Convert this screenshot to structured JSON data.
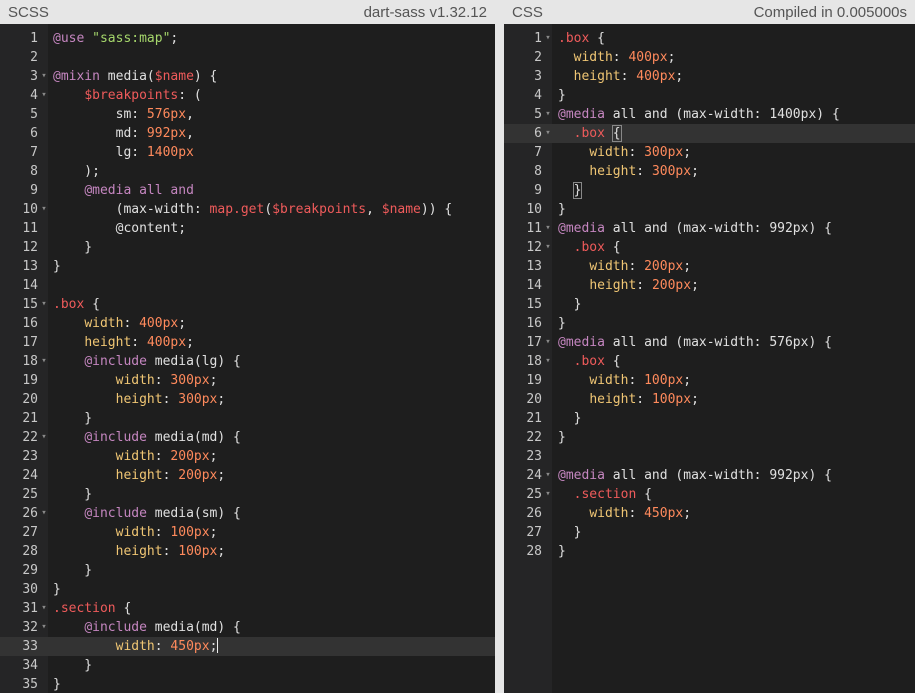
{
  "scss_pane": {
    "title": "SCSS",
    "compiler": "dart-sass v1.32.12",
    "lines": [
      {
        "n": "1",
        "fold": false,
        "tokens": [
          [
            "kw",
            "@use "
          ],
          [
            "str",
            "\"sass:map\""
          ],
          [
            "plain",
            ";"
          ]
        ]
      },
      {
        "n": "2",
        "fold": false,
        "tokens": []
      },
      {
        "n": "3",
        "fold": true,
        "tokens": [
          [
            "kw",
            "@mixin "
          ],
          [
            "plain",
            "media("
          ],
          [
            "var",
            "$name"
          ],
          [
            "plain",
            ") {"
          ]
        ]
      },
      {
        "n": "4",
        "fold": true,
        "tokens": [
          [
            "plain",
            "    "
          ],
          [
            "var",
            "$breakpoints"
          ],
          [
            "plain",
            ": ("
          ]
        ]
      },
      {
        "n": "5",
        "fold": false,
        "tokens": [
          [
            "plain",
            "        sm: "
          ],
          [
            "num",
            "576px"
          ],
          [
            "plain",
            ","
          ]
        ]
      },
      {
        "n": "6",
        "fold": false,
        "tokens": [
          [
            "plain",
            "        md: "
          ],
          [
            "num",
            "992px"
          ],
          [
            "plain",
            ","
          ]
        ]
      },
      {
        "n": "7",
        "fold": false,
        "tokens": [
          [
            "plain",
            "        lg: "
          ],
          [
            "num",
            "1400px"
          ]
        ]
      },
      {
        "n": "8",
        "fold": false,
        "tokens": [
          [
            "plain",
            "    );"
          ]
        ]
      },
      {
        "n": "9",
        "fold": false,
        "tokens": [
          [
            "plain",
            "    "
          ],
          [
            "kw",
            "@media "
          ],
          [
            "kw",
            "all "
          ],
          [
            "kw",
            "and"
          ]
        ]
      },
      {
        "n": "10",
        "fold": true,
        "tokens": [
          [
            "plain",
            "        (max-width: "
          ],
          [
            "fn",
            "map.get"
          ],
          [
            "plain",
            "("
          ],
          [
            "var",
            "$breakpoints"
          ],
          [
            "plain",
            ", "
          ],
          [
            "var",
            "$name"
          ],
          [
            "plain",
            ")) {"
          ]
        ]
      },
      {
        "n": "11",
        "fold": false,
        "tokens": [
          [
            "plain",
            "        @content;"
          ]
        ]
      },
      {
        "n": "12",
        "fold": false,
        "tokens": [
          [
            "plain",
            "    }"
          ]
        ]
      },
      {
        "n": "13",
        "fold": false,
        "tokens": [
          [
            "plain",
            "}"
          ]
        ]
      },
      {
        "n": "14",
        "fold": false,
        "tokens": []
      },
      {
        "n": "15",
        "fold": true,
        "tokens": [
          [
            "sel",
            ".box"
          ],
          [
            "plain",
            " {"
          ]
        ]
      },
      {
        "n": "16",
        "fold": false,
        "tokens": [
          [
            "plain",
            "    "
          ],
          [
            "prop",
            "width"
          ],
          [
            "plain",
            ": "
          ],
          [
            "num",
            "400px"
          ],
          [
            "plain",
            ";"
          ]
        ]
      },
      {
        "n": "17",
        "fold": false,
        "tokens": [
          [
            "plain",
            "    "
          ],
          [
            "prop",
            "height"
          ],
          [
            "plain",
            ": "
          ],
          [
            "num",
            "400px"
          ],
          [
            "plain",
            ";"
          ]
        ]
      },
      {
        "n": "18",
        "fold": true,
        "tokens": [
          [
            "plain",
            "    "
          ],
          [
            "kw",
            "@include "
          ],
          [
            "plain",
            "media(lg) {"
          ]
        ]
      },
      {
        "n": "19",
        "fold": false,
        "tokens": [
          [
            "plain",
            "        "
          ],
          [
            "prop",
            "width"
          ],
          [
            "plain",
            ": "
          ],
          [
            "num",
            "300px"
          ],
          [
            "plain",
            ";"
          ]
        ]
      },
      {
        "n": "20",
        "fold": false,
        "tokens": [
          [
            "plain",
            "        "
          ],
          [
            "prop",
            "height"
          ],
          [
            "plain",
            ": "
          ],
          [
            "num",
            "300px"
          ],
          [
            "plain",
            ";"
          ]
        ]
      },
      {
        "n": "21",
        "fold": false,
        "tokens": [
          [
            "plain",
            "    }"
          ]
        ]
      },
      {
        "n": "22",
        "fold": true,
        "tokens": [
          [
            "plain",
            "    "
          ],
          [
            "kw",
            "@include "
          ],
          [
            "plain",
            "media(md) {"
          ]
        ]
      },
      {
        "n": "23",
        "fold": false,
        "tokens": [
          [
            "plain",
            "        "
          ],
          [
            "prop",
            "width"
          ],
          [
            "plain",
            ": "
          ],
          [
            "num",
            "200px"
          ],
          [
            "plain",
            ";"
          ]
        ]
      },
      {
        "n": "24",
        "fold": false,
        "tokens": [
          [
            "plain",
            "        "
          ],
          [
            "prop",
            "height"
          ],
          [
            "plain",
            ": "
          ],
          [
            "num",
            "200px"
          ],
          [
            "plain",
            ";"
          ]
        ]
      },
      {
        "n": "25",
        "fold": false,
        "tokens": [
          [
            "plain",
            "    }"
          ]
        ]
      },
      {
        "n": "26",
        "fold": true,
        "tokens": [
          [
            "plain",
            "    "
          ],
          [
            "kw",
            "@include "
          ],
          [
            "plain",
            "media(sm) {"
          ]
        ]
      },
      {
        "n": "27",
        "fold": false,
        "tokens": [
          [
            "plain",
            "        "
          ],
          [
            "prop",
            "width"
          ],
          [
            "plain",
            ": "
          ],
          [
            "num",
            "100px"
          ],
          [
            "plain",
            ";"
          ]
        ]
      },
      {
        "n": "28",
        "fold": false,
        "tokens": [
          [
            "plain",
            "        "
          ],
          [
            "prop",
            "height"
          ],
          [
            "plain",
            ": "
          ],
          [
            "num",
            "100px"
          ],
          [
            "plain",
            ";"
          ]
        ]
      },
      {
        "n": "29",
        "fold": false,
        "tokens": [
          [
            "plain",
            "    }"
          ]
        ]
      },
      {
        "n": "30",
        "fold": false,
        "tokens": [
          [
            "plain",
            "}"
          ]
        ]
      },
      {
        "n": "31",
        "fold": true,
        "tokens": [
          [
            "sel",
            ".section"
          ],
          [
            "plain",
            " {"
          ]
        ]
      },
      {
        "n": "32",
        "fold": true,
        "tokens": [
          [
            "plain",
            "    "
          ],
          [
            "kw",
            "@include "
          ],
          [
            "plain",
            "media(md) {"
          ]
        ]
      },
      {
        "n": "33",
        "fold": false,
        "active": true,
        "cursor_after": true,
        "tokens": [
          [
            "plain",
            "        "
          ],
          [
            "prop",
            "width"
          ],
          [
            "plain",
            ": "
          ],
          [
            "num",
            "450px"
          ],
          [
            "plain",
            ";"
          ]
        ]
      },
      {
        "n": "34",
        "fold": false,
        "tokens": [
          [
            "plain",
            "    }"
          ]
        ]
      },
      {
        "n": "35",
        "fold": false,
        "tokens": [
          [
            "plain",
            "}"
          ]
        ]
      }
    ]
  },
  "css_pane": {
    "title": "CSS",
    "status": "Compiled in 0.005000s",
    "lines": [
      {
        "n": "1",
        "fold": true,
        "tokens": [
          [
            "sel",
            ".box"
          ],
          [
            "plain",
            " {"
          ]
        ]
      },
      {
        "n": "2",
        "fold": false,
        "tokens": [
          [
            "plain",
            "  "
          ],
          [
            "prop",
            "width"
          ],
          [
            "plain",
            ": "
          ],
          [
            "num",
            "400px"
          ],
          [
            "plain",
            ";"
          ]
        ]
      },
      {
        "n": "3",
        "fold": false,
        "tokens": [
          [
            "plain",
            "  "
          ],
          [
            "prop",
            "height"
          ],
          [
            "plain",
            ": "
          ],
          [
            "num",
            "400px"
          ],
          [
            "plain",
            ";"
          ]
        ]
      },
      {
        "n": "4",
        "fold": false,
        "tokens": [
          [
            "plain",
            "}"
          ]
        ]
      },
      {
        "n": "5",
        "fold": true,
        "tokens": [
          [
            "kw",
            "@media "
          ],
          [
            "plain",
            "all and (max-width: 1400px) {"
          ]
        ]
      },
      {
        "n": "6",
        "fold": true,
        "active": true,
        "tokens": [
          [
            "plain",
            "  "
          ],
          [
            "sel",
            ".box"
          ],
          [
            "plain",
            " "
          ],
          [
            "match",
            "{"
          ]
        ]
      },
      {
        "n": "7",
        "fold": false,
        "tokens": [
          [
            "plain",
            "    "
          ],
          [
            "prop",
            "width"
          ],
          [
            "plain",
            ": "
          ],
          [
            "num",
            "300px"
          ],
          [
            "plain",
            ";"
          ]
        ]
      },
      {
        "n": "8",
        "fold": false,
        "tokens": [
          [
            "plain",
            "    "
          ],
          [
            "prop",
            "height"
          ],
          [
            "plain",
            ": "
          ],
          [
            "num",
            "300px"
          ],
          [
            "plain",
            ";"
          ]
        ]
      },
      {
        "n": "9",
        "fold": false,
        "tokens": [
          [
            "plain",
            "  "
          ],
          [
            "match",
            "}"
          ]
        ]
      },
      {
        "n": "10",
        "fold": false,
        "tokens": [
          [
            "plain",
            "}"
          ]
        ]
      },
      {
        "n": "11",
        "fold": true,
        "tokens": [
          [
            "kw",
            "@media "
          ],
          [
            "plain",
            "all and (max-width: 992px) {"
          ]
        ]
      },
      {
        "n": "12",
        "fold": true,
        "tokens": [
          [
            "plain",
            "  "
          ],
          [
            "sel",
            ".box"
          ],
          [
            "plain",
            " {"
          ]
        ]
      },
      {
        "n": "13",
        "fold": false,
        "tokens": [
          [
            "plain",
            "    "
          ],
          [
            "prop",
            "width"
          ],
          [
            "plain",
            ": "
          ],
          [
            "num",
            "200px"
          ],
          [
            "plain",
            ";"
          ]
        ]
      },
      {
        "n": "14",
        "fold": false,
        "tokens": [
          [
            "plain",
            "    "
          ],
          [
            "prop",
            "height"
          ],
          [
            "plain",
            ": "
          ],
          [
            "num",
            "200px"
          ],
          [
            "plain",
            ";"
          ]
        ]
      },
      {
        "n": "15",
        "fold": false,
        "tokens": [
          [
            "plain",
            "  }"
          ]
        ]
      },
      {
        "n": "16",
        "fold": false,
        "tokens": [
          [
            "plain",
            "}"
          ]
        ]
      },
      {
        "n": "17",
        "fold": true,
        "tokens": [
          [
            "kw",
            "@media "
          ],
          [
            "plain",
            "all and (max-width: 576px) {"
          ]
        ]
      },
      {
        "n": "18",
        "fold": true,
        "tokens": [
          [
            "plain",
            "  "
          ],
          [
            "sel",
            ".box"
          ],
          [
            "plain",
            " {"
          ]
        ]
      },
      {
        "n": "19",
        "fold": false,
        "tokens": [
          [
            "plain",
            "    "
          ],
          [
            "prop",
            "width"
          ],
          [
            "plain",
            ": "
          ],
          [
            "num",
            "100px"
          ],
          [
            "plain",
            ";"
          ]
        ]
      },
      {
        "n": "20",
        "fold": false,
        "tokens": [
          [
            "plain",
            "    "
          ],
          [
            "prop",
            "height"
          ],
          [
            "plain",
            ": "
          ],
          [
            "num",
            "100px"
          ],
          [
            "plain",
            ";"
          ]
        ]
      },
      {
        "n": "21",
        "fold": false,
        "tokens": [
          [
            "plain",
            "  }"
          ]
        ]
      },
      {
        "n": "22",
        "fold": false,
        "tokens": [
          [
            "plain",
            "}"
          ]
        ]
      },
      {
        "n": "23",
        "fold": false,
        "tokens": []
      },
      {
        "n": "24",
        "fold": true,
        "tokens": [
          [
            "kw",
            "@media "
          ],
          [
            "plain",
            "all and (max-width: 992px) {"
          ]
        ]
      },
      {
        "n": "25",
        "fold": true,
        "tokens": [
          [
            "plain",
            "  "
          ],
          [
            "sel",
            ".section"
          ],
          [
            "plain",
            " {"
          ]
        ]
      },
      {
        "n": "26",
        "fold": false,
        "tokens": [
          [
            "plain",
            "    "
          ],
          [
            "prop",
            "width"
          ],
          [
            "plain",
            ": "
          ],
          [
            "num",
            "450px"
          ],
          [
            "plain",
            ";"
          ]
        ]
      },
      {
        "n": "27",
        "fold": false,
        "tokens": [
          [
            "plain",
            "  }"
          ]
        ]
      },
      {
        "n": "28",
        "fold": false,
        "tokens": [
          [
            "plain",
            "}"
          ]
        ]
      }
    ]
  },
  "icons": {
    "fold": "chevron-down-icon"
  },
  "colors": {
    "editor_bg": "#1e1e1e",
    "gutter_bg": "#252526",
    "header_bg": "#e6e6e6",
    "keyword": "#c586c0",
    "string": "#a5d66b",
    "variable": "#ef5b5b",
    "number": "#ff8a5c",
    "property": "#f0c674"
  }
}
